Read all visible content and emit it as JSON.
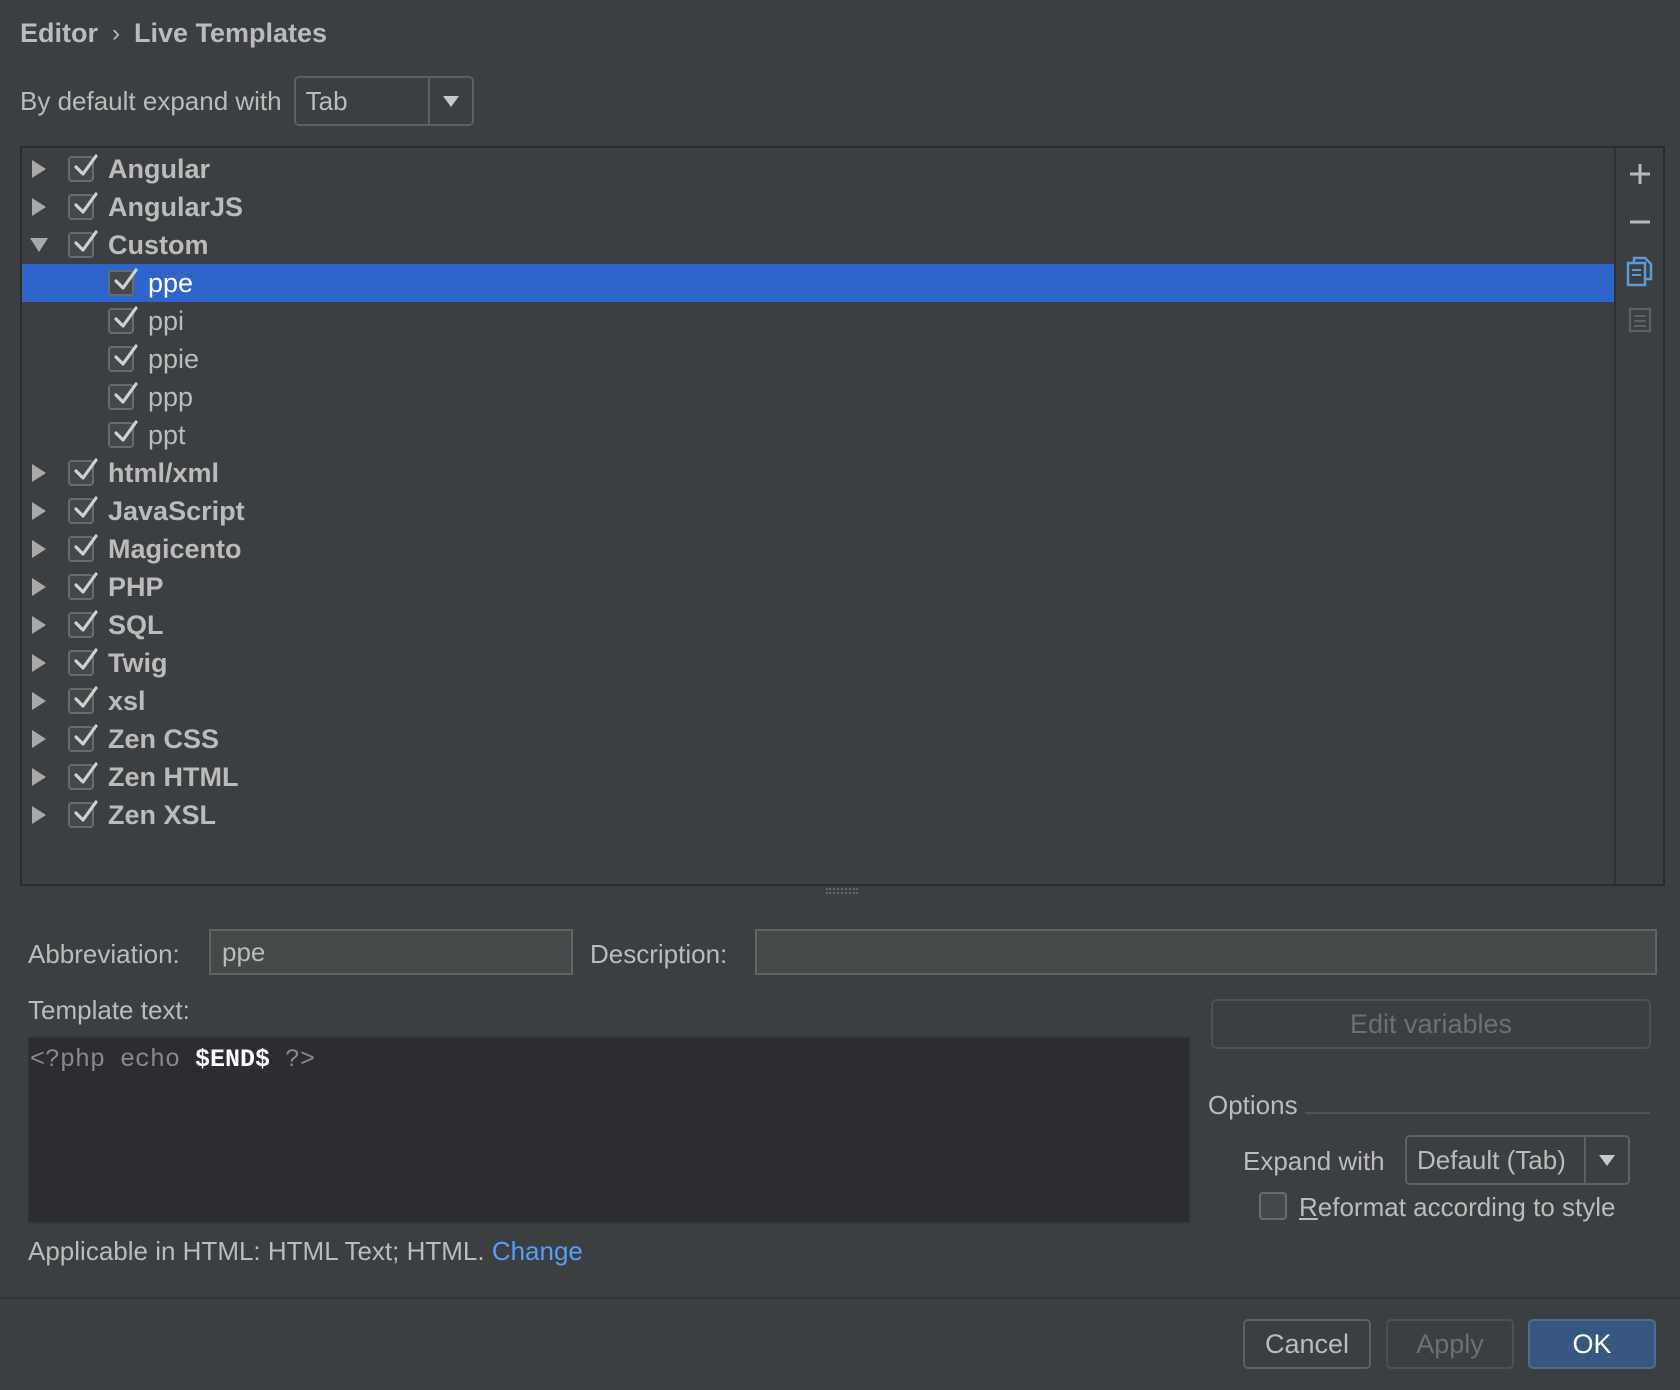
{
  "breadcrumb": {
    "parent": "Editor",
    "separator": "›",
    "current": "Live Templates"
  },
  "default_expand": {
    "label": "By default expand with",
    "value": "Tab"
  },
  "tree": {
    "groups": [
      {
        "label": "Angular",
        "checked": true,
        "expanded": false
      },
      {
        "label": "AngularJS",
        "checked": true,
        "expanded": false
      },
      {
        "label": "Custom",
        "checked": true,
        "expanded": true,
        "children": [
          {
            "label": "ppe",
            "checked": true,
            "selected": true
          },
          {
            "label": "ppi",
            "checked": true
          },
          {
            "label": "ppie",
            "checked": true
          },
          {
            "label": "ppp",
            "checked": true
          },
          {
            "label": "ppt",
            "checked": true
          }
        ]
      },
      {
        "label": "html/xml",
        "checked": true,
        "expanded": false
      },
      {
        "label": "JavaScript",
        "checked": true,
        "expanded": false
      },
      {
        "label": "Magicento",
        "checked": true,
        "expanded": false
      },
      {
        "label": "PHP",
        "checked": true,
        "expanded": false
      },
      {
        "label": "SQL",
        "checked": true,
        "expanded": false
      },
      {
        "label": "Twig",
        "checked": true,
        "expanded": false
      },
      {
        "label": "xsl",
        "checked": true,
        "expanded": false
      },
      {
        "label": "Zen CSS",
        "checked": true,
        "expanded": false
      },
      {
        "label": "Zen HTML",
        "checked": true,
        "expanded": false
      },
      {
        "label": "Zen XSL",
        "checked": true,
        "expanded": false
      }
    ],
    "tools": [
      "add-icon",
      "remove-icon",
      "copy-icon",
      "restore-icon"
    ]
  },
  "details": {
    "abbreviation_label": "Abbreviation:",
    "abbreviation_value": "ppe",
    "description_label": "Description:",
    "description_value": "",
    "template_text_label": "Template text:",
    "template_code": {
      "prefix": "<?php echo ",
      "end_var": "$END$",
      "suffix": " ?>"
    },
    "edit_variables_label": "Edit variables",
    "options_title": "Options",
    "expand_with_label": "Expand with",
    "expand_with_value": "Default (Tab)",
    "reformat_label": "Reformat according to style",
    "reformat_checked": false,
    "applicable_text": "Applicable in HTML: HTML Text; HTML.",
    "change_link": "Change"
  },
  "buttons": {
    "cancel": "Cancel",
    "apply": "Apply",
    "ok": "OK"
  },
  "colors": {
    "background": "#3c3f41",
    "selection": "#2f65ca",
    "link": "#589df6",
    "primary_button": "#365880"
  }
}
